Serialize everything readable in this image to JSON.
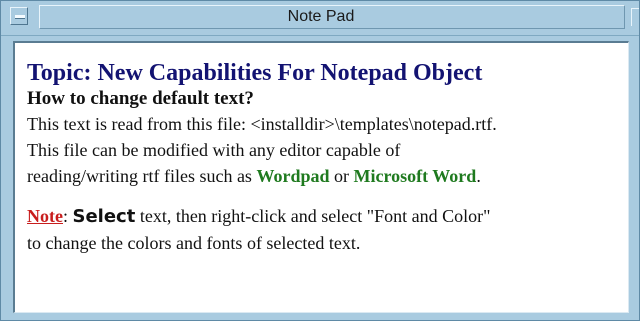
{
  "window": {
    "title": "Note Pad"
  },
  "content": {
    "topic": "Topic: New Capabilities For Notepad Object",
    "question": "How to change default text?",
    "line1": "This text is read from this file: <installdir>\\templates\\notepad.rtf.",
    "line2": "This file can be modified with any editor capable of",
    "line3_prefix": "reading/writing rtf files such as ",
    "wordpad": "Wordpad",
    "line3_middle": " or ",
    "microsoft_word": "Microsoft Word",
    "line3_suffix": ".",
    "note_label": "Note",
    "note_colon": ": ",
    "select_word": "Select",
    "note_text": " text, then right-click and select \"Font and Color\"",
    "note_line2": "to change the colors and fonts of selected text."
  },
  "colors": {
    "window_chrome": "#a9cbe0",
    "topic": "#131372",
    "green_links": "#1f7a1f",
    "note_red": "#c81d1d"
  },
  "icons": {
    "system_menu": "minimize-dash-icon"
  }
}
